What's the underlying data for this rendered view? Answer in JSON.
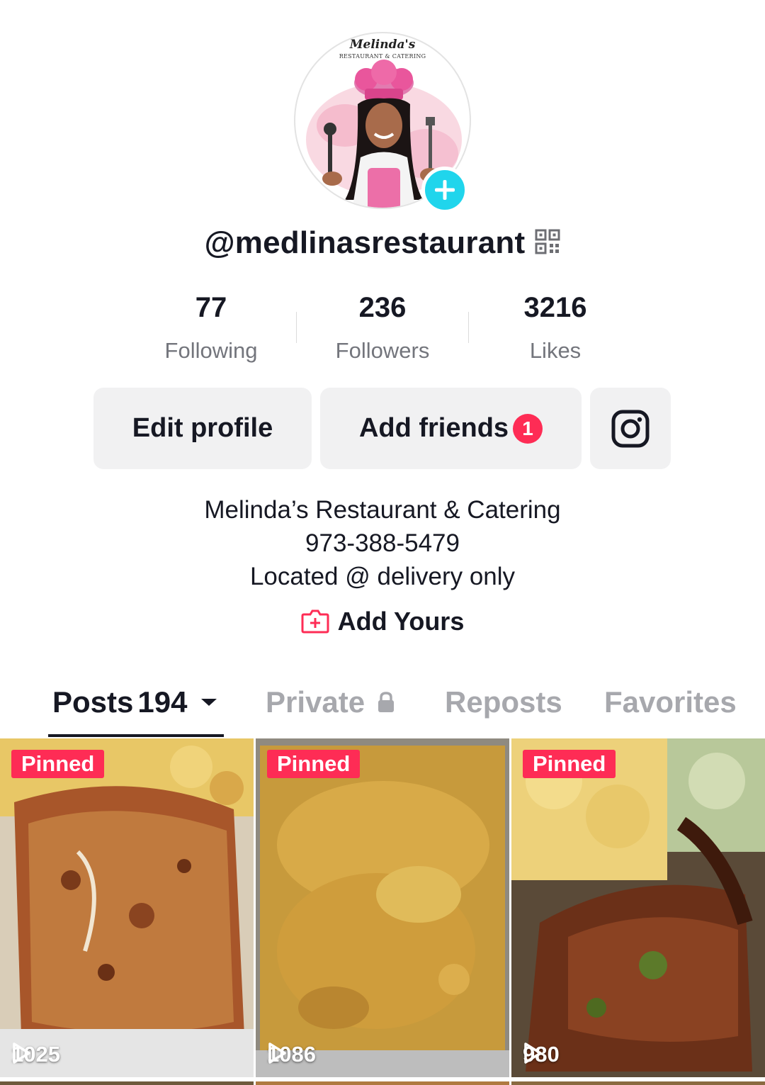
{
  "profile": {
    "avatar_logo_title": "Melinda's",
    "avatar_logo_subtitle": "RESTAURANT & CATERING",
    "username": "@medlinasrestaurant"
  },
  "stats": [
    {
      "value": "77",
      "label": "Following"
    },
    {
      "value": "236",
      "label": "Followers"
    },
    {
      "value": "3216",
      "label": "Likes"
    }
  ],
  "actions": {
    "edit_profile": "Edit profile",
    "add_friends": "Add friends",
    "add_friends_badge": "1",
    "instagram_icon": "instagram-icon"
  },
  "bio": {
    "line1": "Melinda’s Restaurant & Catering",
    "line2": "973-388-5479",
    "line3": "Located @ delivery only",
    "add_yours": "Add Yours"
  },
  "tabs": {
    "posts": "Posts",
    "posts_count": "194",
    "private": "Private",
    "reposts": "Reposts",
    "favorites": "Favorites"
  },
  "grid": [
    {
      "pinned": "Pinned",
      "views": "1025"
    },
    {
      "pinned": "Pinned",
      "views": "1086"
    },
    {
      "pinned": "Pinned",
      "views": "980"
    }
  ],
  "colors": {
    "accent_red": "#fe2c55",
    "add_cyan": "#20d5ec",
    "muted_text": "#73757c",
    "button_bg": "#f1f1f2"
  }
}
